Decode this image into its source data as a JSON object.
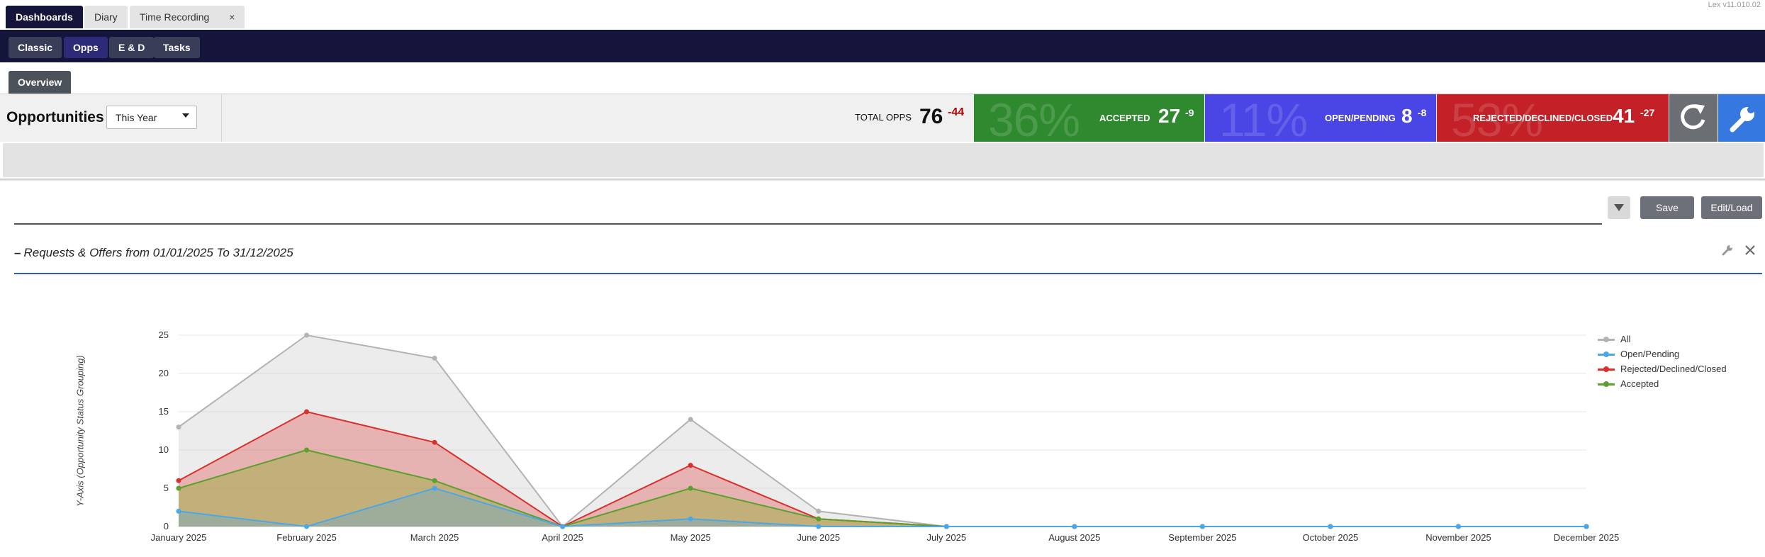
{
  "top_tabs": [
    {
      "label": "Dashboards"
    },
    {
      "label": "Diary"
    },
    {
      "label": "Time Recording",
      "close": "×"
    }
  ],
  "version": "Lex v11.010.02",
  "nav": [
    "Classic",
    "Opps",
    "E & D",
    "Tasks"
  ],
  "overview_tab": "Overview",
  "opportunities": {
    "title": "Opportunities",
    "period": "This Year",
    "total_label": "TOTAL OPPS",
    "total_value": "76",
    "total_delta": "-44"
  },
  "stats": [
    {
      "pct": "36%",
      "label": "ACCEPTED",
      "value": "27",
      "delta": "-9",
      "color": "#2f8a2f"
    },
    {
      "pct": "11%",
      "label": "OPEN/PENDING",
      "value": "8",
      "delta": "-8",
      "color": "#4a46e6"
    },
    {
      "pct": "53%",
      "label": "REJECTED/DECLINED/CLOSED",
      "value": "41",
      "delta": "-27",
      "color": "#c32127"
    }
  ],
  "toolbar": {
    "save": "Save",
    "edit_load": "Edit/Load"
  },
  "chart_header": {
    "dash": "–",
    "title": "Requests & Offers from 01/01/2025 To 31/12/2025"
  },
  "chart_data": {
    "type": "area",
    "ylabel": "Y-Axis (Opportunity Status Grouping)",
    "ylim": [
      0,
      25
    ],
    "yticks": [
      0,
      5,
      10,
      15,
      20,
      25
    ],
    "grid": true,
    "legend_position": "right",
    "categories": [
      "January 2025",
      "February 2025",
      "March 2025",
      "April 2025",
      "May 2025",
      "June 2025",
      "July 2025",
      "August 2025",
      "September 2025",
      "October 2025",
      "November 2025",
      "December 2025"
    ],
    "series": [
      {
        "name": "All",
        "color": "#b3b3b3",
        "fill": "rgba(200,200,200,0.35)",
        "values": [
          13,
          25,
          22,
          0,
          14,
          2,
          0,
          0,
          0,
          0,
          0,
          0
        ]
      },
      {
        "name": "Open/Pending",
        "color": "#4aa8e8",
        "fill": "rgba(74,168,232,0.30)",
        "values": [
          2,
          0,
          5,
          0,
          1,
          0,
          0,
          0,
          0,
          0,
          0,
          0
        ]
      },
      {
        "name": "Rejected/Declined/Closed",
        "color": "#d9302c",
        "fill": "rgba(217,48,44,0.30)",
        "values": [
          6,
          15,
          11,
          0,
          8,
          1,
          0,
          0,
          0,
          0,
          0,
          0
        ]
      },
      {
        "name": "Accepted",
        "color": "#5aa02c",
        "fill": "rgba(150,170,50,0.45)",
        "values": [
          5,
          10,
          6,
          0,
          5,
          1,
          0,
          0,
          0,
          0,
          0,
          0
        ]
      }
    ]
  }
}
